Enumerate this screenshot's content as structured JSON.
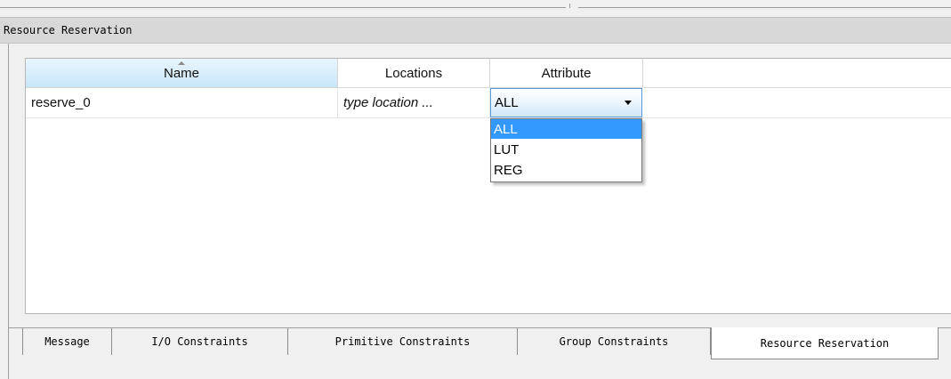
{
  "panel": {
    "title": "Resource Reservation"
  },
  "table": {
    "columns": [
      "Name",
      "Locations",
      "Attribute"
    ],
    "rows": [
      {
        "name": "reserve_0",
        "locations": "type location ...",
        "attribute": "ALL"
      }
    ]
  },
  "attribute_dropdown": {
    "selected": "ALL",
    "options": [
      "ALL",
      "LUT",
      "REG"
    ]
  },
  "tabs": [
    {
      "label": "Message",
      "active": false
    },
    {
      "label": "I/O Constraints",
      "active": false
    },
    {
      "label": "Primitive Constraints",
      "active": false
    },
    {
      "label": "Group Constraints",
      "active": false
    },
    {
      "label": "Resource Reservation",
      "active": true
    }
  ],
  "colors": {
    "selection": "#3399ff",
    "header_sorted": "#c8e6f8",
    "combo_border": "#5a9ad6"
  }
}
